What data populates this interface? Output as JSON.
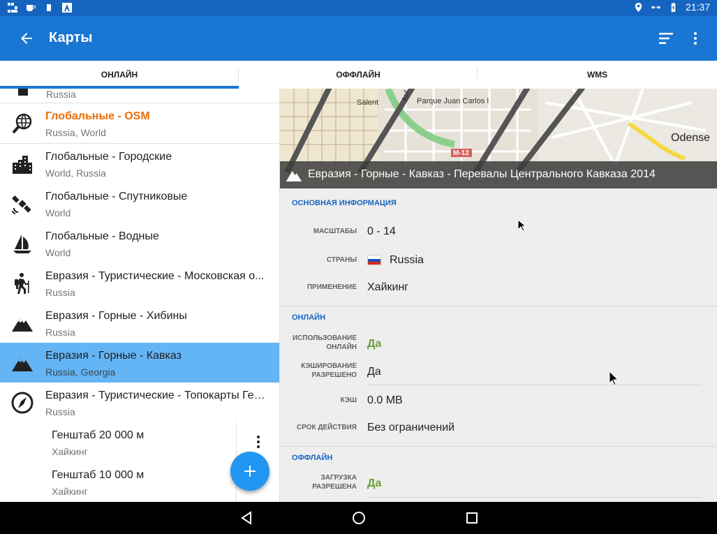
{
  "status_bar": {
    "time": "21:37"
  },
  "app_bar": {
    "title": "Карты"
  },
  "tabs": [
    {
      "label": "ОНЛАЙН",
      "active": true
    },
    {
      "label": "ОФФЛАЙН",
      "active": false
    },
    {
      "label": "WMS",
      "active": false
    }
  ],
  "list": {
    "top_partial_subtitle": "Russia",
    "items": [
      {
        "title": "Глобальные - OSM",
        "subtitle": "Russia, World",
        "icon": "globe-search-icon",
        "highlight": true
      },
      {
        "title": "Глобальные - Городские",
        "subtitle": "World, Russia",
        "icon": "city-buildings-icon"
      },
      {
        "title": "Глобальные - Спутниковые",
        "subtitle": "World",
        "icon": "satellite-icon"
      },
      {
        "title": "Глобальные - Водные",
        "subtitle": "World",
        "icon": "sailboat-icon"
      },
      {
        "title": "Евразия - Туристические - Московская о...",
        "subtitle": "Russia",
        "icon": "hiker-icon"
      },
      {
        "title": "Евразия - Горные - Хибины",
        "subtitle": "Russia",
        "icon": "mountain-icon"
      },
      {
        "title": "Евразия - Горные - Кавказ",
        "subtitle": "Russia, Georgia",
        "icon": "mountain-icon",
        "selected": true
      },
      {
        "title": "Евразия - Туристические - Топокарты Ген...",
        "subtitle": "Russia",
        "icon": "compass-icon"
      }
    ],
    "sub_items": [
      {
        "title": "Генштаб 20 000 м",
        "subtitle": "Хайкинг"
      },
      {
        "title": "Генштаб 10 000 м",
        "subtitle": "Хайкинг"
      }
    ]
  },
  "detail": {
    "map_title": "Евразия - Горные - Кавказ - Перевалы Центрального Кавказа 2014",
    "map_labels": {
      "salent": "Salent",
      "park": "Parque Juan Carlos I",
      "odense": "Odense",
      "road": "M-12",
      "au": "Aut"
    },
    "basic": {
      "heading": "ОСНОВНАЯ ИНФОРМАЦИЯ",
      "scales_label": "МАСШТАБЫ",
      "scales_value": "0 - 14",
      "countries_label": "СТРАНЫ",
      "countries_value": "Russia",
      "usage_label": "ПРИМЕНЕНИЕ",
      "usage_value": "Хайкинг"
    },
    "online": {
      "heading": "ОНЛАЙН",
      "use_label_1": "ИСПОЛЬЗОВАНИЕ",
      "use_label_2": "ОНЛАЙН",
      "use_value": "Да",
      "cache_allowed_label_1": "КЭШИРОВАНИЕ",
      "cache_allowed_label_2": "РАЗРЕШЕНО",
      "cache_allowed_value": "Да",
      "cache_label": "КЭШ",
      "cache_value": "0.0 MB",
      "validity_label": "СРОК ДЕЙСТВИЯ",
      "validity_value": "Без ограничений"
    },
    "offline": {
      "heading": "ОФФЛАЙН",
      "download_label_1": "ЗАГРУЗКА",
      "download_label_2": "РАЗРЕШЕНА",
      "download_value": "Да"
    }
  },
  "colors": {
    "primary": "#1976d2",
    "status": "#1565c0",
    "selected": "#64b5f6",
    "accent_orange": "#ef6c00",
    "green": "#689f38"
  }
}
